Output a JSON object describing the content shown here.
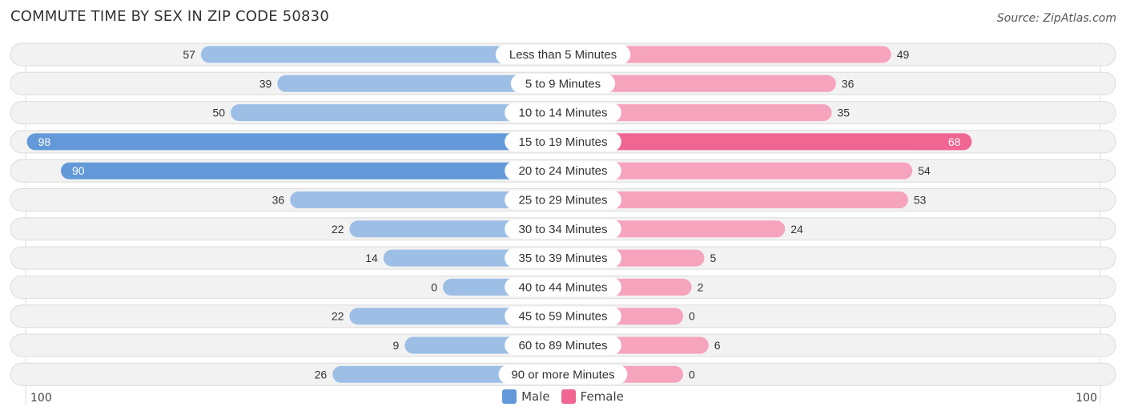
{
  "title": "COMMUTE TIME BY SEX IN ZIP CODE 50830",
  "source": "Source: ZipAtlas.com",
  "colors": {
    "male_strong": "#6399d8",
    "male_light": "#9dbfe6",
    "female_strong": "#f06592",
    "female_light": "#f6a3bd",
    "track": "#f2f2f2",
    "text": "#333333"
  },
  "chart_data": {
    "type": "bar",
    "orientation": "horizontal-diverging",
    "title": "COMMUTE TIME BY SEX IN ZIP CODE 50830",
    "categories": [
      "Less than 5 Minutes",
      "5 to 9 Minutes",
      "10 to 14 Minutes",
      "15 to 19 Minutes",
      "20 to 24 Minutes",
      "25 to 29 Minutes",
      "30 to 34 Minutes",
      "35 to 39 Minutes",
      "40 to 44 Minutes",
      "45 to 59 Minutes",
      "60 to 89 Minutes",
      "90 or more Minutes"
    ],
    "series": [
      {
        "name": "Male",
        "values": [
          57,
          39,
          50,
          98,
          90,
          36,
          22,
          14,
          0,
          22,
          9,
          26
        ]
      },
      {
        "name": "Female",
        "values": [
          49,
          36,
          35,
          68,
          54,
          53,
          24,
          5,
          2,
          0,
          6,
          0
        ]
      }
    ],
    "axis_min_label": "100",
    "axis_max_label": "100",
    "xlim": [
      -100,
      100
    ],
    "legend": [
      "Male",
      "Female"
    ],
    "legend_position": "bottom-center"
  }
}
